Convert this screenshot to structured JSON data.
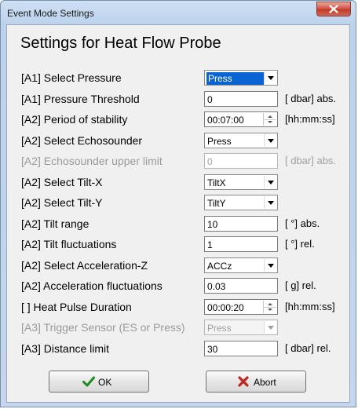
{
  "window": {
    "title": "Event Mode Settings"
  },
  "heading": "Settings for Heat Flow Probe",
  "rows": [
    {
      "label": "[A1] Select Pressure",
      "type": "select",
      "value": "Press",
      "unit": "",
      "enabled": true,
      "focused": true
    },
    {
      "label": "[A1] Pressure Threshold",
      "type": "text",
      "value": "0",
      "unit": "[ dbar] abs.",
      "enabled": true
    },
    {
      "label": "[A2] Period of stability",
      "type": "spin",
      "value": "00:07:00",
      "unit": "[hh:mm:ss]",
      "enabled": true
    },
    {
      "label": "[A2] Select Echosounder",
      "type": "select",
      "value": "Press",
      "unit": "",
      "enabled": true
    },
    {
      "label": "[A2] Echosounder upper limit",
      "type": "text",
      "value": "0",
      "unit": "[ dbar] abs.",
      "enabled": false
    },
    {
      "label": "[A2] Select Tilt-X",
      "type": "select",
      "value": "TiltX",
      "unit": "",
      "enabled": true
    },
    {
      "label": "[A2] Select Tilt-Y",
      "type": "select",
      "value": "TiltY",
      "unit": "",
      "enabled": true
    },
    {
      "label": "[A2] Tilt range",
      "type": "text",
      "value": "10",
      "unit": "[   °] abs.",
      "enabled": true
    },
    {
      "label": "[A2] Tilt fluctuations",
      "type": "text",
      "value": "1",
      "unit": "[   °] rel.",
      "enabled": true
    },
    {
      "label": "[A2] Select Acceleration-Z",
      "type": "select",
      "value": "ACCz",
      "unit": "",
      "enabled": true
    },
    {
      "label": "[A2] Acceleration fluctuations",
      "type": "text",
      "value": "0.03",
      "unit": "[   g] rel.",
      "enabled": true
    },
    {
      "label": "[   ] Heat Pulse Duration",
      "type": "spin",
      "value": "00:00:20",
      "unit": "[hh:mm:ss]",
      "enabled": true
    },
    {
      "label": "[A3] Trigger Sensor (ES or Press)",
      "type": "select",
      "value": "Press",
      "unit": "",
      "enabled": false
    },
    {
      "label": "[A3] Distance limit",
      "type": "text",
      "value": "30",
      "unit": "[ dbar] rel.",
      "enabled": true
    }
  ],
  "buttons": {
    "ok": "OK",
    "abort": "Abort"
  },
  "colors": {
    "ok_check": "#1e8a1e",
    "abort_x": "#c0281c",
    "selection": "#0a64d2"
  },
  "icons": {
    "close": "close-icon",
    "ok": "checkmark-icon",
    "abort": "x-icon"
  }
}
